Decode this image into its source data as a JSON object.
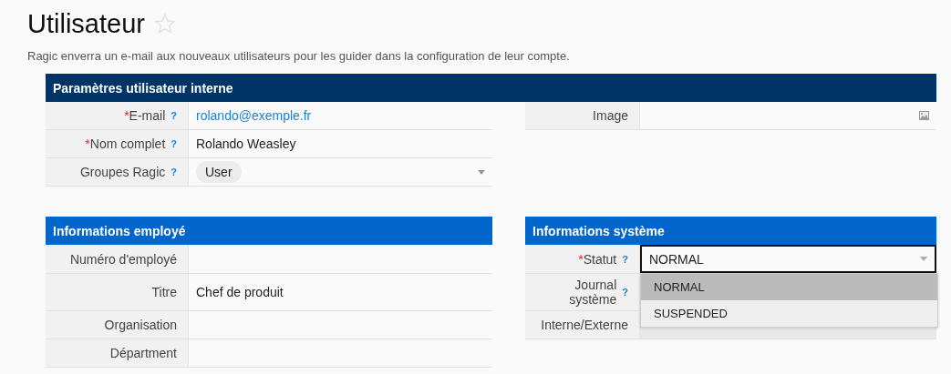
{
  "page": {
    "title": "Utilisateur",
    "favorite": false,
    "description": "Ragic enverra un e-mail aux nouveaux utilisateurs pour les guider dans la configuration de leur compte."
  },
  "sections": [
    {
      "title": "Paramètres utilisateur interne",
      "color": "#003366",
      "left": [
        {
          "label": "E-mail",
          "required_mark": "*",
          "help": "?",
          "kind": "link",
          "value": "rolando@exemple.fr"
        },
        {
          "label": "Nom complet",
          "required_mark": "*",
          "help": "?",
          "kind": "text",
          "value": "Rolando Weasley"
        },
        {
          "label": "Groupes Ragic",
          "help": "?",
          "kind": "tags",
          "tags": [
            "User"
          ]
        }
      ],
      "right": [
        {
          "label": "Image",
          "kind": "image"
        }
      ]
    },
    {
      "title": "Informations employé",
      "color": "#0066cc",
      "left": [
        {
          "label": "Numéro d'employé",
          "kind": "text"
        },
        {
          "label": "Titre",
          "kind": "text",
          "value": "Chef de produit"
        },
        {
          "label": "Organisation",
          "kind": "text"
        },
        {
          "label": "Départment",
          "kind": "text"
        }
      ]
    },
    {
      "title": "Informations système",
      "color": "#0066cc",
      "left": [
        {
          "label": "Statut",
          "required_mark": "*",
          "help": "?",
          "kind": "select",
          "value": "NORMAL",
          "expanded": true,
          "options": [
            {
              "label": "NORMAL",
              "selected": true
            },
            {
              "label": "SUSPENDED",
              "selected": false
            }
          ]
        },
        {
          "label": "Journal système",
          "help": "?",
          "kind": "text"
        },
        {
          "label": "Interne/Externe",
          "kind": "readonly"
        }
      ]
    }
  ]
}
